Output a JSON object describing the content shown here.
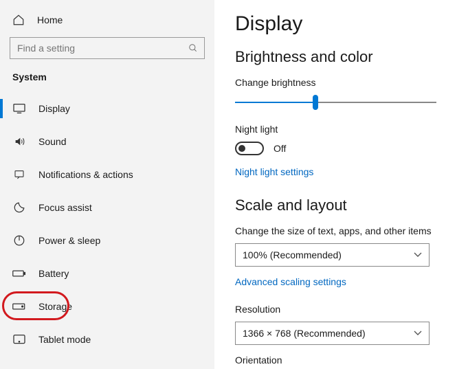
{
  "sidebar": {
    "home": "Home",
    "search_placeholder": "Find a setting",
    "section": "System",
    "items": [
      {
        "icon": "display",
        "label": "Display",
        "active": true
      },
      {
        "icon": "sound",
        "label": "Sound"
      },
      {
        "icon": "notifications",
        "label": "Notifications & actions"
      },
      {
        "icon": "focus",
        "label": "Focus assist"
      },
      {
        "icon": "power",
        "label": "Power & sleep"
      },
      {
        "icon": "battery",
        "label": "Battery"
      },
      {
        "icon": "storage",
        "label": "Storage",
        "highlighted": true
      },
      {
        "icon": "tablet",
        "label": "Tablet mode"
      }
    ]
  },
  "main": {
    "title": "Display",
    "brightness_section": "Brightness and color",
    "brightness_label": "Change brightness",
    "brightness_percent": 40,
    "night_light_label": "Night light",
    "night_light_state": "Off",
    "night_light_link": "Night light settings",
    "scale_section": "Scale and layout",
    "scale_label": "Change the size of text, apps, and other items",
    "scale_value": "100% (Recommended)",
    "advanced_link": "Advanced scaling settings",
    "resolution_label": "Resolution",
    "resolution_value": "1366 × 768 (Recommended)",
    "orientation_label": "Orientation"
  }
}
